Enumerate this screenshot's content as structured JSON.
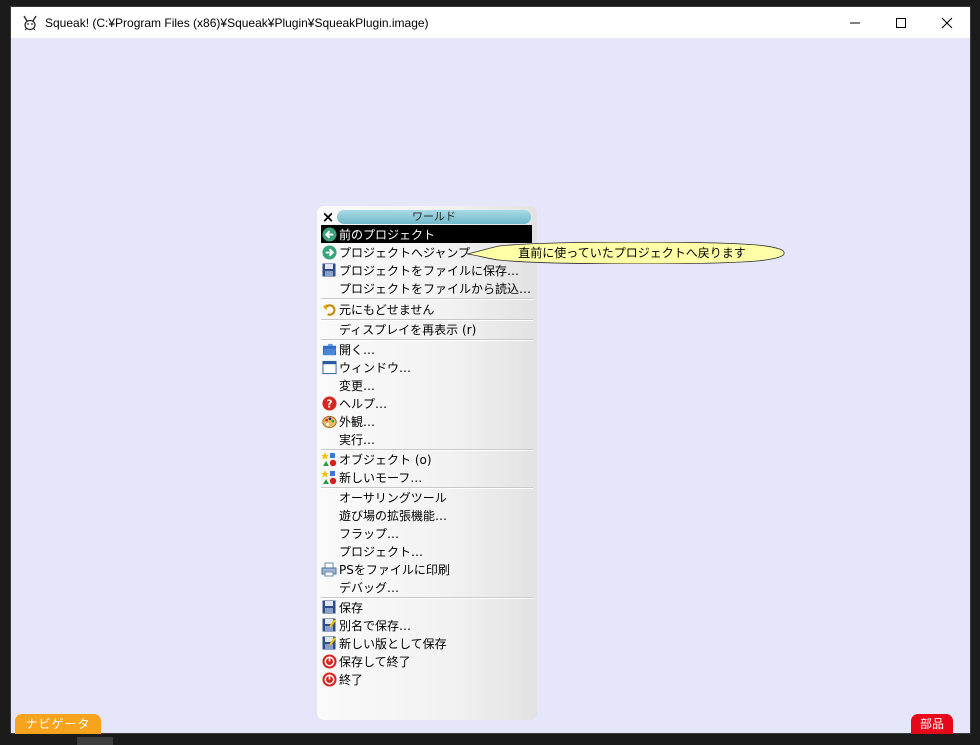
{
  "window": {
    "title": "Squeak! (C:¥Program Files (x86)¥Squeak¥Plugin¥SqueakPlugin.image)",
    "icon": "squeak-mouse-icon",
    "controls": [
      "minimize-icon",
      "maximize-icon",
      "close-icon"
    ]
  },
  "menu": {
    "title": "ワールド",
    "close": "×",
    "items": [
      {
        "label": "前のプロジェクト",
        "icon": "back-arrow-icon",
        "selected": true
      },
      {
        "label": "プロジェクトへジャンプ",
        "icon": "forward-arrow-icon"
      },
      {
        "label": "プロジェクトをファイルに保存…",
        "icon": "floppy-icon"
      },
      {
        "label": "プロジェクトをファイルから読込…",
        "icon": ""
      },
      {
        "label": "元にもどせません",
        "icon": "undo-icon"
      },
      {
        "label": "ディスプレイを再表示 (r)",
        "icon": ""
      },
      {
        "label": "開く…",
        "icon": "open-folder-icon"
      },
      {
        "label": "ウィンドウ…",
        "icon": "window-icon"
      },
      {
        "label": "変更…",
        "icon": ""
      },
      {
        "label": "ヘルプ…",
        "icon": "help-icon"
      },
      {
        "label": "外観…",
        "icon": "palette-icon"
      },
      {
        "label": "実行…",
        "icon": ""
      },
      {
        "label": "オブジェクト (o)",
        "icon": "objects-icon"
      },
      {
        "label": "新しいモーフ…",
        "icon": "new-morph-icon"
      },
      {
        "label": "オーサリングツール",
        "icon": ""
      },
      {
        "label": "遊び場の拡張機能…",
        "icon": ""
      },
      {
        "label": "フラップ…",
        "icon": ""
      },
      {
        "label": "プロジェクト…",
        "icon": ""
      },
      {
        "label": "PSをファイルに印刷",
        "icon": "printer-icon"
      },
      {
        "label": "デバッグ…",
        "icon": ""
      },
      {
        "label": "保存",
        "icon": "save-icon"
      },
      {
        "label": "別名で保存…",
        "icon": "save-as-icon"
      },
      {
        "label": "新しい版として保存",
        "icon": "save-version-icon"
      },
      {
        "label": "保存して終了",
        "icon": "save-quit-icon"
      },
      {
        "label": "終了",
        "icon": "quit-icon"
      }
    ]
  },
  "balloon": {
    "text": "直前に使っていたプロジェクトへ戻ります"
  },
  "flaps": {
    "navigator": "ナビゲータ",
    "parts": "部品"
  },
  "colors": {
    "desktop": "#e6e6fb",
    "menu_title": "#6fb8ca",
    "balloon": "#ffffa8",
    "navigator_flap": "#f6a31e",
    "parts_flap": "#e7071b"
  }
}
